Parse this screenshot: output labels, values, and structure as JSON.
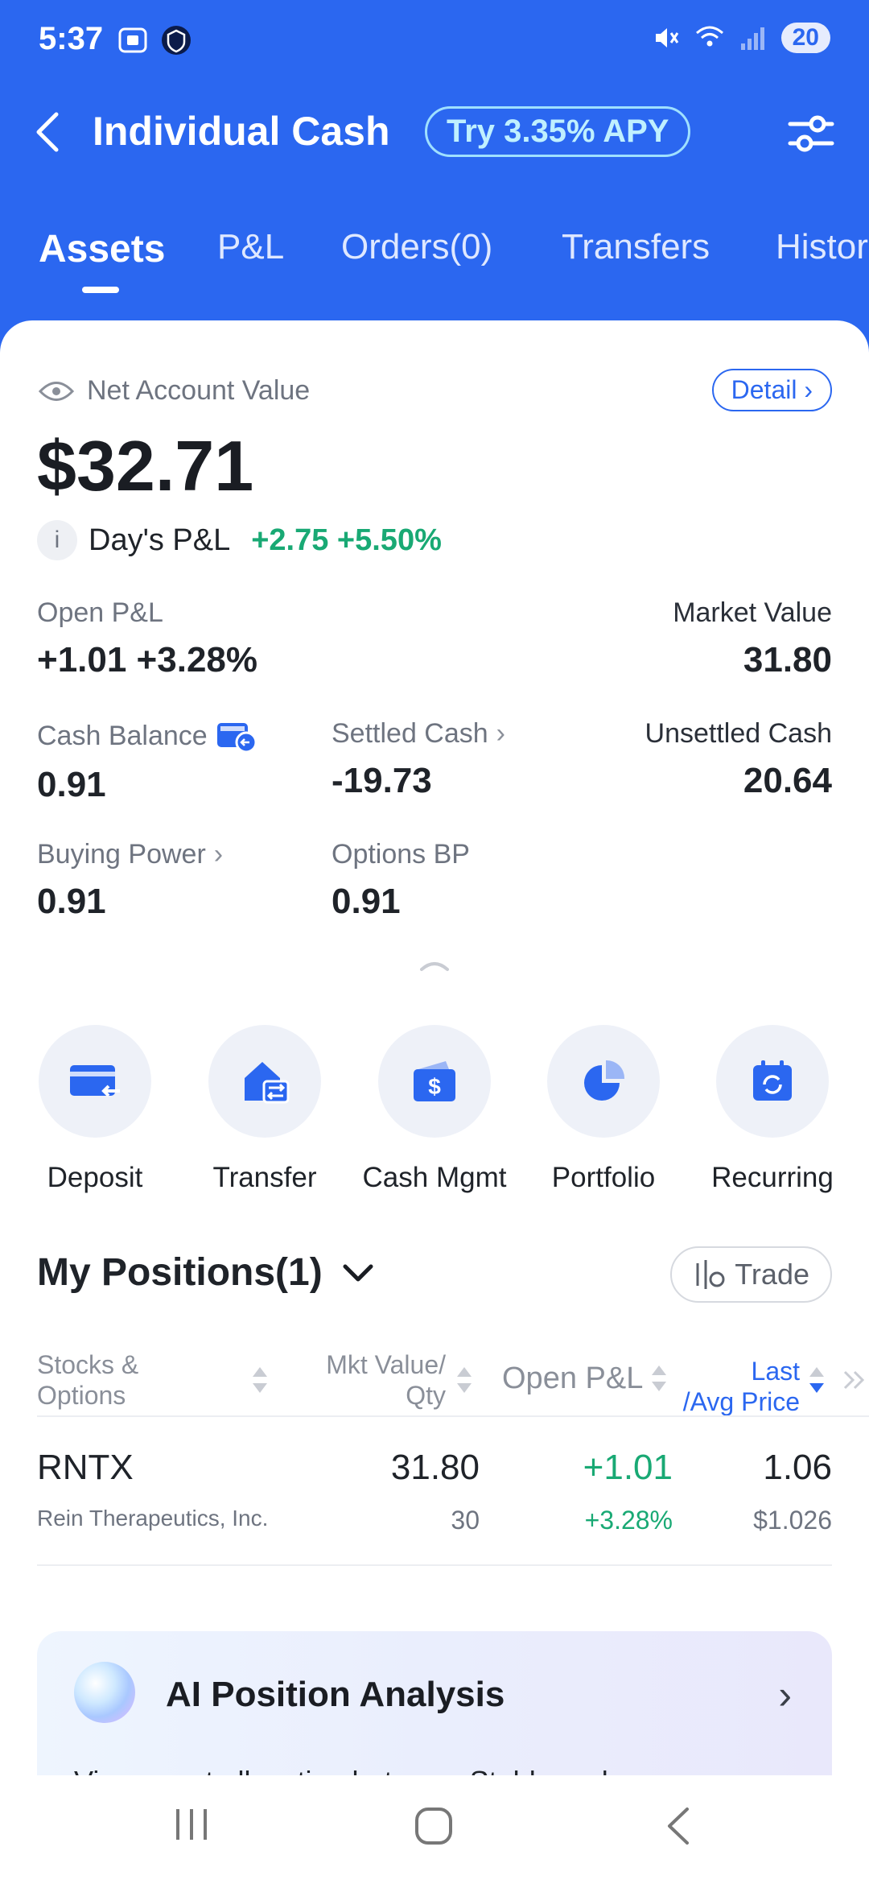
{
  "status_bar": {
    "time": "5:37",
    "battery": "20"
  },
  "header": {
    "title": "Individual Cash",
    "apy_badge": "Try 3.35% APY"
  },
  "tabs": [
    {
      "label": "Assets",
      "active": true
    },
    {
      "label": "P&L"
    },
    {
      "label": "Orders(0)"
    },
    {
      "label": "Transfers"
    },
    {
      "label": "Histor"
    }
  ],
  "account": {
    "net_label": "Net Account Value",
    "detail_label": "Detail",
    "net_value": "$32.71",
    "days_pl_label": "Day's P&L",
    "days_pl_value": "+2.75 +5.50%"
  },
  "metrics": {
    "open_pl": {
      "label": "Open P&L",
      "value": "+1.01 +3.28%"
    },
    "market_value": {
      "label": "Market Value",
      "value": "31.80"
    },
    "cash_balance": {
      "label": "Cash Balance",
      "value": "0.91"
    },
    "settled_cash": {
      "label": "Settled Cash",
      "value": "-19.73"
    },
    "unsettled_cash": {
      "label": "Unsettled Cash",
      "value": "20.64"
    },
    "buying_power": {
      "label": "Buying Power",
      "value": "0.91"
    },
    "options_bp": {
      "label": "Options BP",
      "value": "0.91"
    }
  },
  "actions": [
    {
      "label": "Deposit",
      "icon": "deposit-card-icon"
    },
    {
      "label": "Transfer",
      "icon": "transfer-house-icon"
    },
    {
      "label": "Cash Mgmt",
      "icon": "wallet-dollar-icon"
    },
    {
      "label": "Portfolio",
      "icon": "pie-chart-icon"
    },
    {
      "label": "Recurring",
      "icon": "calendar-refresh-icon"
    }
  ],
  "positions": {
    "title": "My Positions(1)",
    "trade_label": "Trade",
    "columns": {
      "stocks_line1": "Stocks &",
      "stocks_line2": "Options",
      "mkt_line1": "Mkt Value/",
      "mkt_line2": "Qty",
      "open_pl": "Open P&L",
      "last_line1": "Last",
      "last_line2": "/Avg Price"
    },
    "rows": [
      {
        "ticker": "RNTX",
        "name": "Rein Therapeutics, Inc.",
        "mkt_value": "31.80",
        "qty": "30",
        "open_pl": "+1.01",
        "open_pl_pct": "+3.28%",
        "last": "1.06",
        "avg_price": "$1.026"
      }
    ]
  },
  "ai_card": {
    "title": "AI Position Analysis",
    "desc": "View asset allocation between Stable and"
  },
  "colors": {
    "brand_blue": "#2b67f0",
    "gain_green": "#19a974"
  }
}
